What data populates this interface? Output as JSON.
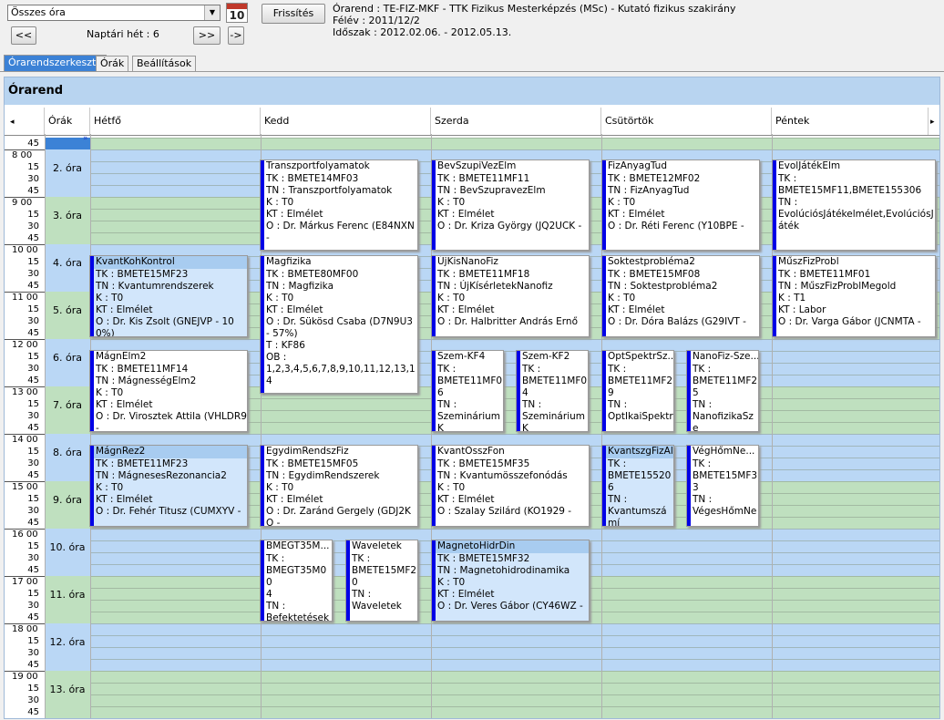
{
  "toolbar": {
    "filter_value": "Összes óra",
    "prev_label": "<<",
    "next_label": ">>",
    "goto_label": "->",
    "week_label": "Naptári hét : 6",
    "refresh_label": "Frissítés",
    "calendar_day": "10"
  },
  "info": {
    "line1": "Órarend : TE-FIZ-MKF - TTK Fizikus Mesterképzés (MSc) - Kutató fizikus szakirány",
    "line2": "Félév : 2011/12/2",
    "line3": "Időszak : 2012.02.06. - 2012.05.13."
  },
  "tabs": [
    "Órarendszerkesztő",
    "Órák",
    "Beállítások"
  ],
  "panel_title": "Órarend",
  "columns": [
    "Órák",
    "Hétfő",
    "Kedd",
    "Szerda",
    "Csütörtök",
    "Péntek"
  ],
  "time_labels": [
    "45",
    "8 00",
    "15",
    "30",
    "45",
    "9 00",
    "15",
    "30",
    "45",
    "10 00",
    "15",
    "30",
    "45",
    "11 00",
    "15",
    "30",
    "45",
    "12 00",
    "15",
    "30",
    "45",
    "13 00",
    "15",
    "30",
    "45",
    "14 00",
    "15",
    "30",
    "45",
    "15 00",
    "15",
    "30",
    "45",
    "16 00",
    "15",
    "30",
    "45",
    "17 00",
    "15",
    "30",
    "45",
    "18 00",
    "15",
    "30",
    "45",
    "19 00",
    "15",
    "30",
    "45"
  ],
  "ora_labels": [
    "2. óra",
    "3. óra",
    "4. óra",
    "5. óra",
    "6. óra",
    "7. óra",
    "8. óra",
    "9. óra",
    "10. óra",
    "11. óra",
    "12. óra",
    "13. óra"
  ],
  "accent": "#0000e6",
  "cards": [
    {
      "title": "Transzportfolyamatok",
      "lines": [
        "TK : BMETE14MF03",
        "TN : Transzportfolyamatok",
        "K : T0",
        "KT : Elmélet",
        "O :  Dr. Márkus Ferenc (E84NXN -"
      ]
    },
    {
      "title": "BevSzupiVezElm",
      "lines": [
        "TK : BMETE11MF11",
        "TN : BevSzupravezElm",
        "K : T0",
        "KT : Elmélet",
        "O :  Dr. Kriza György (JQ2UCK -"
      ]
    },
    {
      "title": "FizAnyagTud",
      "lines": [
        "TK : BMETE12MF02",
        "TN : FizAnyagTud",
        "K : T0",
        "KT : Elmélet",
        "O :  Dr. Réti Ferenc (Y10BPE -"
      ]
    },
    {
      "title": "EvolJátékElm",
      "lines": [
        "TK :",
        "BMETE15MF11,BMETE155306",
        "TN :",
        "EvolúciósJátékelmélet,EvolúciósJáték"
      ]
    },
    {
      "title": "KvantKohKontrol",
      "lines": [
        "TK : BMETE15MF23",
        "TN : Kvantumrendszerek",
        "K : T0",
        "KT : Elmélet",
        "O :  Dr. Kis Zsolt (GNEJVP - 100%)"
      ]
    },
    {
      "title": "Magfizika",
      "lines": [
        "TK : BMETE80MF00",
        "TN : Magfizika",
        "K : T0",
        "KT : Elmélet",
        "O :  Dr. Sükösd Csaba (D7N9U3 - 57%)",
        "T : KF86",
        "OB :",
        "1,2,3,4,5,6,7,8,9,10,11,12,13,14"
      ]
    },
    {
      "title": "ÚjKisNanoFiz",
      "lines": [
        "TK : BMETE11MF18",
        "TN : ÚjKísérletekNanofiz",
        "K : T0",
        "KT : Elmélet",
        "O :  Dr. Halbritter András Ernő"
      ]
    },
    {
      "title": "Soktestprobléma2",
      "lines": [
        "TK : BMETE15MF08",
        "TN : Soktestprobléma2",
        "K : T0",
        "KT : Elmélet",
        "O :  Dr. Dóra Balázs (G29IVT -"
      ]
    },
    {
      "title": "MűszFizProbl",
      "lines": [
        "TK : BMETE11MF01",
        "TN : MűszFizProblMegold",
        "K : T1",
        "KT : Labor",
        "O :  Dr. Varga Gábor (JCNMTA -"
      ]
    },
    {
      "title": "MágnElm2",
      "lines": [
        "TK : BMETE11MF14",
        "TN : MágnességElm2",
        "K : T0",
        "KT : Elmélet",
        "O :  Dr. Virosztek Attila (VHLDR9 -"
      ]
    },
    {
      "title": "Szem-KF4",
      "lines": [
        "TK :",
        "BMETE11MF0",
        "6",
        "TN :",
        "SzemináriumK"
      ]
    },
    {
      "title": "Szem-KF2",
      "lines": [
        "TK :",
        "BMETE11MF0",
        "4",
        "TN :",
        "SzemináriumK"
      ]
    },
    {
      "title": "OptSpektrSz...",
      "lines": [
        "TK :",
        "BMETE11MF2",
        "9",
        "TN :",
        "OptIkaiSpektr"
      ]
    },
    {
      "title": "NanoFiz-Sze...",
      "lines": [
        "TK :",
        "BMETE11MF2",
        "5",
        "TN :",
        "NanofizikaSze"
      ]
    },
    {
      "title": "MágnRez2",
      "lines": [
        "TK : BMETE11MF23",
        "TN : MágnesesRezonancia2",
        "K : T0",
        "KT : Elmélet",
        "O :  Dr. Fehér Titusz (CUMXYV -"
      ]
    },
    {
      "title": "EgydimRendszFiz",
      "lines": [
        "TK : BMETE15MF05",
        "TN : EgydimRendszerek",
        "K : T0",
        "KT : Elmélet",
        "O :  Dr. Zaránd Gergely (GDJ2KO -"
      ]
    },
    {
      "title": "KvantÖsszFon",
      "lines": [
        "TK : BMETE15MF35",
        "TN : Kvantumösszefonódás",
        "K : T0",
        "KT : Elmélet",
        "O :  Szalay Szilárd (KO1929 -"
      ]
    },
    {
      "title": "KvantszgFizAl",
      "lines": [
        "TK :",
        "BMETE15520",
        "6",
        "TN :",
        "Kvantumszámí"
      ]
    },
    {
      "title": "VégHőmNe...",
      "lines": [
        "TK :",
        "BMETE15MF3",
        "3",
        "TN :",
        "VégesHőmNe"
      ]
    },
    {
      "title": "BMEGT35M...",
      "lines": [
        "TK :",
        "BMEGT35M00",
        "4",
        "TN :",
        "Befektetések"
      ]
    },
    {
      "title": "Waveletek",
      "lines": [
        "TK :",
        "BMETE15MF2",
        "0",
        "TN :",
        "Waveletek"
      ]
    },
    {
      "title": "MagnetoHidrDin",
      "lines": [
        "TK : BMETE15MF32",
        "TN : Magnetohidrodinamika",
        "K : T0",
        "KT : Elmélet",
        "O :  Dr. Veres Gábor (CY46WZ -"
      ]
    }
  ]
}
